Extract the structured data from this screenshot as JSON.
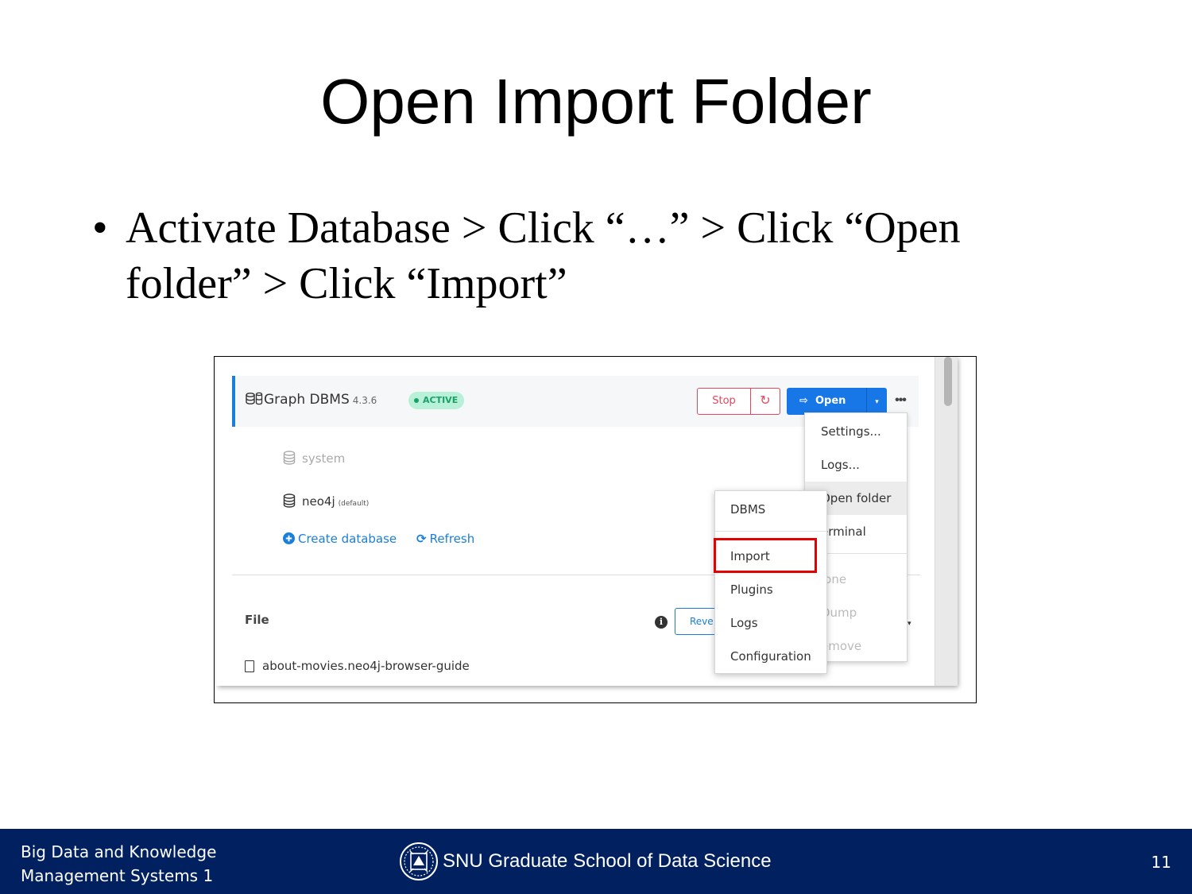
{
  "slide": {
    "title": "Open Import Folder",
    "bullet_mark": "•",
    "bullet_line1": "Activate Database > Click “…” > Click “Open",
    "bullet_line2": "folder” > Click “Import”"
  },
  "screenshot": {
    "dbms": {
      "name": "Graph DBMS",
      "version": "4.3.6",
      "status": "ACTIVE",
      "stop_label": "Stop",
      "open_label": "Open"
    },
    "databases": [
      {
        "name": "system",
        "tag": ""
      },
      {
        "name": "neo4j",
        "tag": "(default)"
      }
    ],
    "actions": {
      "create": "Create database",
      "refresh": "Refresh"
    },
    "file_section": {
      "label": "File",
      "reveal_label": "Reve",
      "file_name": "about-movies.neo4j-browser-guide"
    },
    "more_menu": {
      "items": [
        "Settings...",
        "Logs...",
        "Open folder",
        "Terminal",
        "Clone",
        "Dump",
        "Remove"
      ],
      "visible_items": [
        "Settings...",
        "Logs...",
        "Open folder",
        "erminal",
        "lone",
        "Dump",
        "emove"
      ],
      "hovered": "Open folder"
    },
    "open_folder_submenu": {
      "items": [
        "DBMS",
        "Import",
        "Plugins",
        "Logs",
        "Configuration"
      ],
      "highlighted": "Import",
      "highlight_color": "#e50000"
    },
    "colors": {
      "accent": "#1877e6",
      "stop": "#e0485e",
      "active_badge": "#1ba06a"
    }
  },
  "footer": {
    "course_line1": "Big Data and Knowledge",
    "course_line2": "Management Systems 1",
    "school": "SNU Graduate School of Data Science",
    "page_number": "11",
    "background": "#002060"
  }
}
